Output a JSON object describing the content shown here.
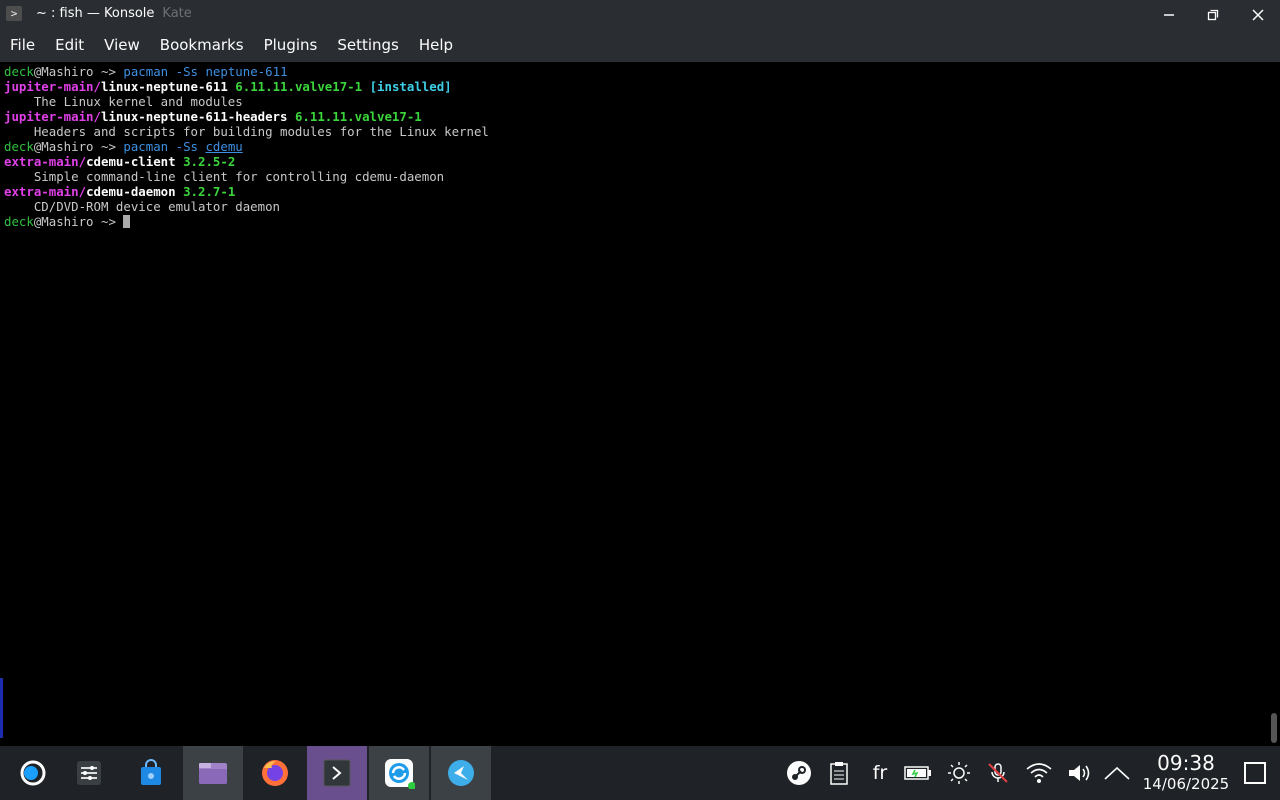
{
  "window": {
    "icon": "terminal-icon",
    "title": "~ : fish — Konsole",
    "ghost_title": "Kate"
  },
  "menubar": {
    "items": [
      "File",
      "Edit",
      "View",
      "Bookmarks",
      "Plugins",
      "Settings",
      "Help"
    ]
  },
  "terminal": {
    "lines": [
      {
        "prompt_user": "deck",
        "prompt_host": "@Mashiro ~>",
        "cmd": "pacman",
        "args": "-Ss",
        "target": "neptune-611"
      },
      {
        "repo": "jupiter-main/",
        "pkg": "linux-neptune-611",
        "ver": "6.11.11.valve17-1",
        "tag": "[installed]"
      },
      {
        "desc": "    The Linux kernel and modules"
      },
      {
        "repo": "jupiter-main/",
        "pkg": "linux-neptune-611-headers",
        "ver": "6.11.11.valve17-1"
      },
      {
        "desc": "    Headers and scripts for building modules for the Linux kernel"
      },
      {
        "prompt_user": "deck",
        "prompt_host": "@Mashiro ~>",
        "cmd": "pacman",
        "args": "-Ss",
        "target": "cdemu"
      },
      {
        "repo": "extra-main/",
        "pkg": "cdemu-client",
        "ver": "3.2.5-2"
      },
      {
        "desc": "    Simple command-line client for controlling cdemu-daemon"
      },
      {
        "repo": "extra-main/",
        "pkg": "cdemu-daemon",
        "ver": "3.2.7-1"
      },
      {
        "desc": "    CD/DVD-ROM device emulator daemon"
      },
      {
        "prompt_user": "deck",
        "prompt_host": "@Mashiro ~>"
      }
    ]
  },
  "taskbar": {
    "apps": [
      "steamdeck-launcher-icon",
      "mixer-settings-icon",
      "discover-store-icon",
      "dolphin-file-manager-icon",
      "firefox-icon",
      "konsole-icon",
      "sync-app-icon",
      "kdeconnect-icon"
    ],
    "tray": {
      "keyboard_layout": "fr",
      "icons": [
        "steam-icon",
        "clipboard-icon",
        "battery-icon",
        "brightness-icon",
        "microphone-muted-icon",
        "wifi-icon",
        "volume-icon",
        "expand-tray-icon"
      ]
    },
    "clock": {
      "time": "09:38",
      "date": "14/06/2025"
    }
  }
}
